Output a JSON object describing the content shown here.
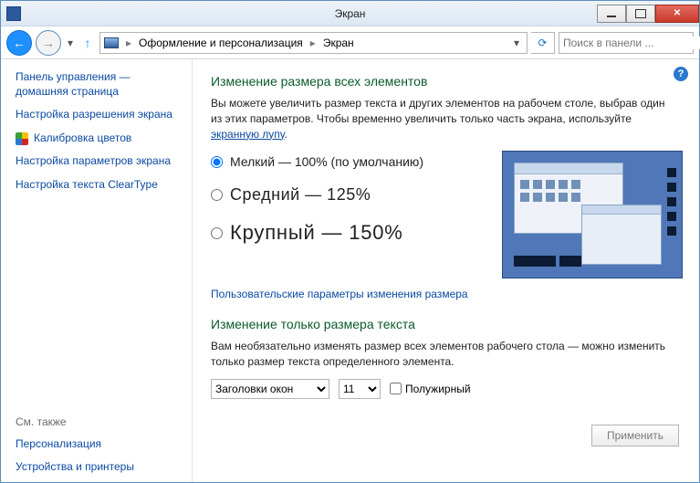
{
  "window": {
    "title": "Экран"
  },
  "nav": {
    "breadcrumb": [
      "Оформление и персонализация",
      "Экран"
    ],
    "search_placeholder": "Поиск в панели ..."
  },
  "sidebar": {
    "items": [
      {
        "label": "Панель управления — домашняя страница"
      },
      {
        "label": "Настройка разрешения экрана"
      },
      {
        "label": "Калибровка цветов",
        "icon": "shield"
      },
      {
        "label": "Настройка параметров экрана"
      },
      {
        "label": "Настройка текста ClearType"
      }
    ],
    "seealso_title": "См. также",
    "seealso": [
      "Персонализация",
      "Устройства и принтеры"
    ]
  },
  "main": {
    "section1_title": "Изменение размера всех элементов",
    "section1_desc_pre": "Вы можете увеличить размер текста и других элементов на рабочем столе, выбрав один из этих параметров. Чтобы временно увеличить только часть экрана, используйте ",
    "section1_desc_link": "экранную лупу",
    "section1_desc_post": ".",
    "radios": [
      {
        "label": "Мелкий — 100% (по умолчанию)",
        "selected": true
      },
      {
        "label": "Средний — 125%",
        "selected": false
      },
      {
        "label": "Крупный — 150%",
        "selected": false
      }
    ],
    "custom_link": "Пользовательские параметры изменения размера",
    "section2_title": "Изменение только размера текста",
    "section2_desc": "Вам необязательно изменять размер всех элементов рабочего стола — можно изменить только размер текста определенного элемента.",
    "element_select": {
      "value": "Заголовки окон"
    },
    "size_select": {
      "value": "11"
    },
    "bold_label": "Полужирный",
    "apply_label": "Применить"
  }
}
